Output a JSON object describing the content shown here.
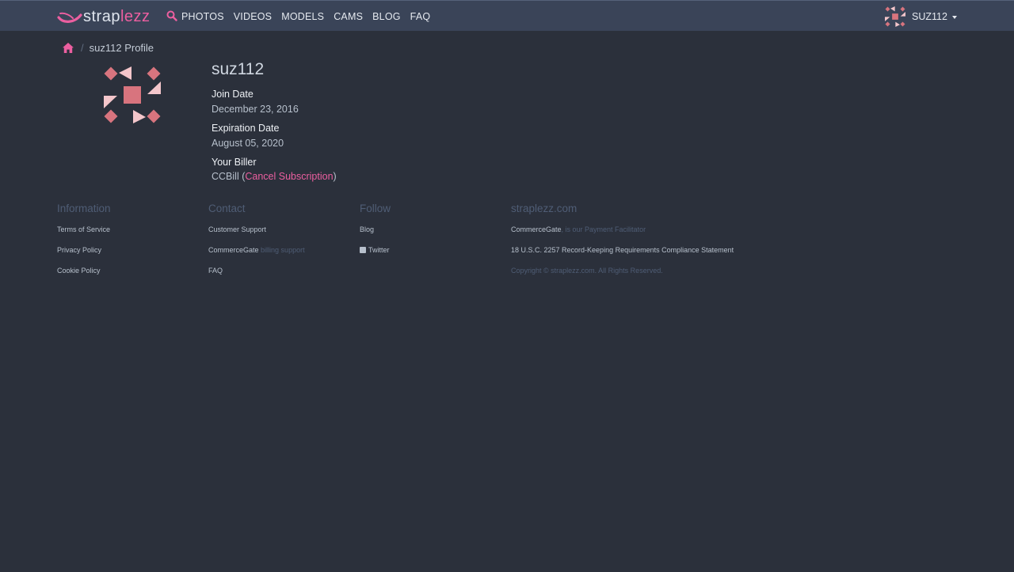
{
  "logo": {
    "part1": "strap",
    "part2": "lezz"
  },
  "nav": {
    "items": [
      "PHOTOS",
      "VIDEOS",
      "MODELS",
      "CAMS",
      "BLOG",
      "FAQ"
    ]
  },
  "user": {
    "name": "SUZ112"
  },
  "breadcrumb": {
    "current": "suz112 Profile"
  },
  "profile": {
    "username": "suz112",
    "join_label": "Join Date",
    "join_value": "December 23, 2016",
    "exp_label": "Expiration Date",
    "exp_value": "August 05, 2020",
    "biller_label": "Your Biller",
    "biller_name": "CCBill (",
    "cancel_link": "Cancel Subscription",
    "biller_close": ")"
  },
  "footer": {
    "information": {
      "title": "Information",
      "links": [
        "Terms of Service",
        "Privacy Policy",
        "Cookie Policy"
      ]
    },
    "contact": {
      "title": "Contact",
      "customer_support": "Customer Support",
      "commercegate": "CommerceGate",
      "billing_support": "billing support",
      "faq": "FAQ"
    },
    "follow": {
      "title": "Follow",
      "blog": "Blog",
      "twitter": "Twitter"
    },
    "site": {
      "title": "straplezz.com",
      "commercegate": "CommerceGate",
      "facilitator": ", is our Payment Facilitator",
      "compliance": "18 U.S.C. 2257 Record-Keeping Requirements Compliance Statement",
      "copyright": "Copyright © straplezz.com. All Rights Reserved."
    }
  },
  "colors": {
    "background": "#2b303b",
    "navbar": "#3a4458",
    "accent": "#ec5fa0",
    "muted": "#4f5d75"
  }
}
